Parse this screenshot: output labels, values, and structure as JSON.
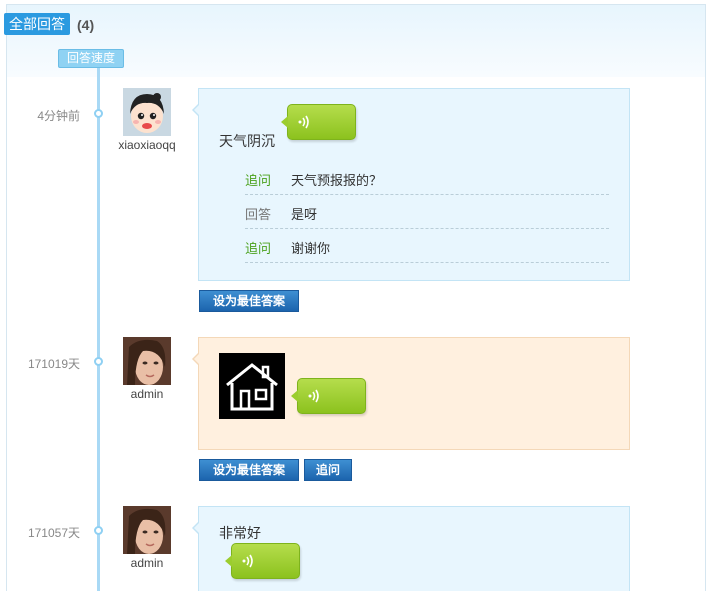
{
  "header": {
    "tab_label": "全部回答",
    "count": "(4)"
  },
  "speed_tag": "回答速度",
  "answers": [
    {
      "time": "4分钟前",
      "username": "xiaoxiaoqq",
      "text": "天气阴沉",
      "thread": [
        {
          "type": "追问",
          "text": "天气预报报的？"
        },
        {
          "type": "回答",
          "text": "是呀"
        },
        {
          "type": "追问",
          "text": "谢谢你"
        }
      ],
      "buttons": [
        "设为最佳答案"
      ]
    },
    {
      "time": "171019天",
      "username": "admin",
      "buttons": [
        "设为最佳答案",
        "追问"
      ]
    },
    {
      "time": "171057天",
      "username": "admin",
      "text": "非常好"
    }
  ],
  "colors": {
    "accent": "#2b9ae0",
    "voice_green": "#8cc21e",
    "follow_up_green": "#4aa11c",
    "button_blue": "#1c64ad"
  }
}
